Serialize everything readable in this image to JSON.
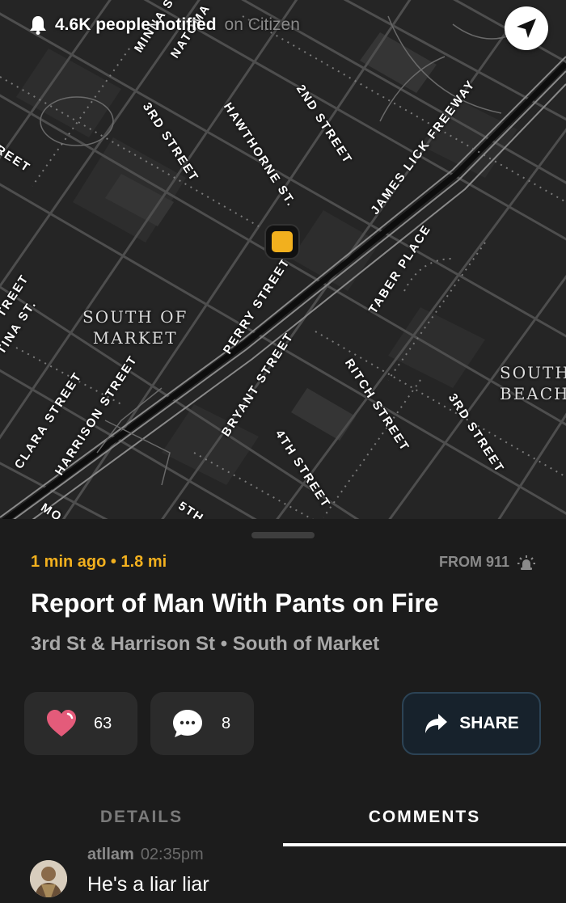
{
  "map": {
    "notified_count": "4.6K people notified",
    "notified_suffix": "on Citizen",
    "area_labels": {
      "south_of_market": "SOUTH OF\nMARKET",
      "south_beach": "SOUTH\nBEACH"
    },
    "street_labels": {
      "minna": "MINNA ST",
      "natoma": "NATOMA",
      "third_street_top": "3RD STREET",
      "hawthorne": "HAWTHORNE ST.",
      "second_street": "2ND STREET",
      "james_lick": "JAMES LICK FREEWAY",
      "street_left_top": "REET",
      "street_left_mid": "TREET",
      "tina": "TINA ST.",
      "perry": "PERRY STREET",
      "taber": "TABER PLACE",
      "clara": "CLARA STREET",
      "harrison": "HARRISON STREET",
      "bryant": "BRYANT STREET",
      "fourth_street": "4TH STREET",
      "ritch": "RITCH STREET",
      "third_street_right": "3RD STREET",
      "mo": "MO",
      "fifth": "5TH"
    }
  },
  "incident": {
    "time_distance": "1 min ago • 1.8 mi",
    "source": "FROM 911",
    "title": "Report of Man With Pants on Fire",
    "location": "3rd St & Harrison St • South of Market"
  },
  "actions": {
    "likes": "63",
    "comments": "8",
    "share_label": "SHARE"
  },
  "tabs": {
    "details": "DETAILS",
    "comments": "COMMENTS",
    "active": "comments"
  },
  "comments_list": [
    {
      "user": "atllam",
      "time": "02:35pm",
      "text": "He's a liar liar"
    }
  ],
  "colors": {
    "accent_yellow": "#f2b01e",
    "like_heart": "#e45b7a",
    "background": "#1c1c1c",
    "map_background": "#262626"
  },
  "icons": {
    "notification": "bell-icon",
    "locate": "navigation-arrow-icon",
    "source": "siren-icon",
    "like": "heart-icon",
    "comment": "chat-bubble-icon",
    "share": "share-arrow-icon"
  }
}
